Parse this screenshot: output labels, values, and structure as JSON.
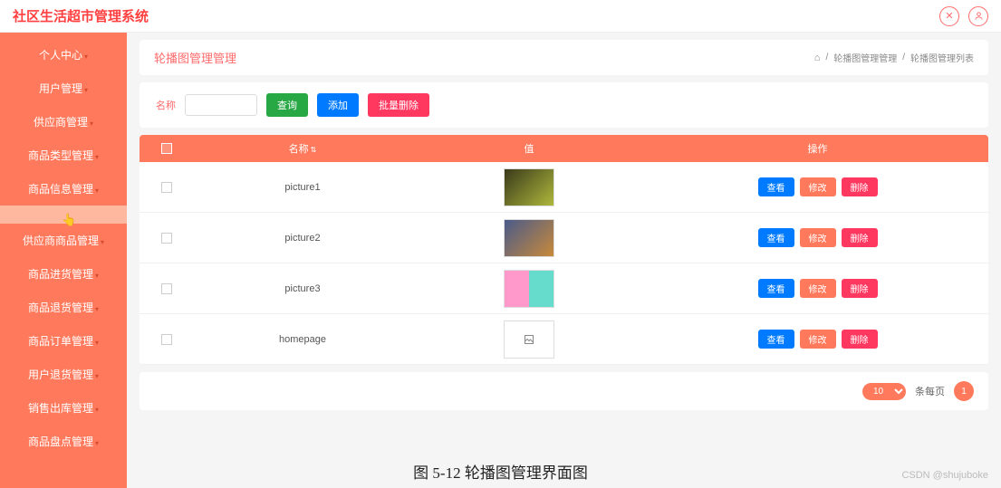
{
  "header": {
    "system_title": "社区生活超市管理系统"
  },
  "sidebar": {
    "items": [
      {
        "label": "个人中心"
      },
      {
        "label": "用户管理"
      },
      {
        "label": "供应商管理"
      },
      {
        "label": "商品类型管理"
      },
      {
        "label": "商品信息管理"
      },
      {
        "label": ""
      },
      {
        "label": "供应商商品管理"
      },
      {
        "label": "商品进货管理"
      },
      {
        "label": "商品退货管理"
      },
      {
        "label": "商品订单管理"
      },
      {
        "label": "用户退货管理"
      },
      {
        "label": "销售出库管理"
      },
      {
        "label": "商品盘点管理"
      }
    ],
    "active_index": 5
  },
  "page": {
    "title": "轮播图管理管理",
    "breadcrumb": [
      "轮播图管理管理",
      "轮播图管理列表"
    ]
  },
  "search": {
    "label": "名称",
    "value": "",
    "query_btn": "查询",
    "add_btn": "添加",
    "batch_delete_btn": "批量删除"
  },
  "table": {
    "headers": {
      "name": "名称",
      "value": "值",
      "ops": "操作"
    },
    "ops": {
      "view": "查看",
      "edit": "修改",
      "delete": "删除"
    },
    "rows": [
      {
        "name": "picture1"
      },
      {
        "name": "picture2"
      },
      {
        "name": "picture3"
      },
      {
        "name": "homepage"
      }
    ]
  },
  "pager": {
    "page_size": "10",
    "per_page_label": "条每页",
    "current": "1"
  },
  "caption": "图 5-12 轮播图管理界面图",
  "watermark": "CSDN @shujuboke"
}
